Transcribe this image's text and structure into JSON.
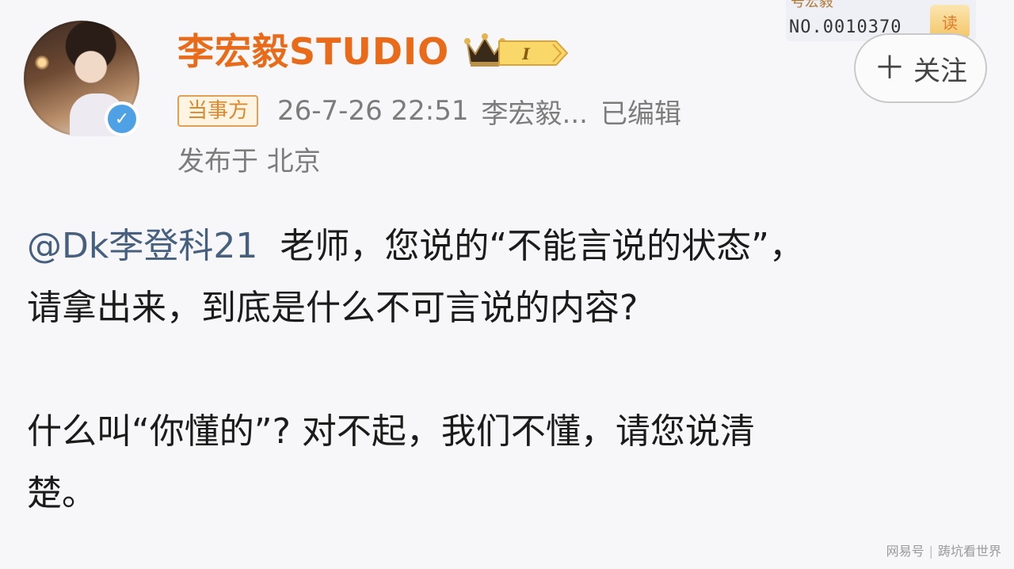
{
  "post": {
    "author": {
      "name": "李宏毅STUDIO",
      "level_badge": "I"
    },
    "party_tag": "当事方",
    "timestamp": "26-7-26 22:51",
    "source": "李宏毅...",
    "edited": "已编辑",
    "location": "发布于 北京",
    "follow_label": "关注",
    "body": {
      "mention": "@Dk李登科21",
      "line1_rest": "  老师，您说的“不能言说的状态”，",
      "line2": "请拿出来，到底是什么不可言说的内容?",
      "line3": "什么叫“你懂的”? 对不起，我们不懂，请您说清",
      "line4": "楚。"
    }
  },
  "corner_tag": {
    "number": "NO.0010370",
    "cut_text": "号宏毅",
    "badge": "读"
  },
  "watermark": {
    "left": "网易号",
    "right": "踌坑看世界"
  },
  "colors": {
    "author": "#e96b1a",
    "meta": "#7c7c7c",
    "mention": "#46607e",
    "verified": "#4fa1e6"
  }
}
